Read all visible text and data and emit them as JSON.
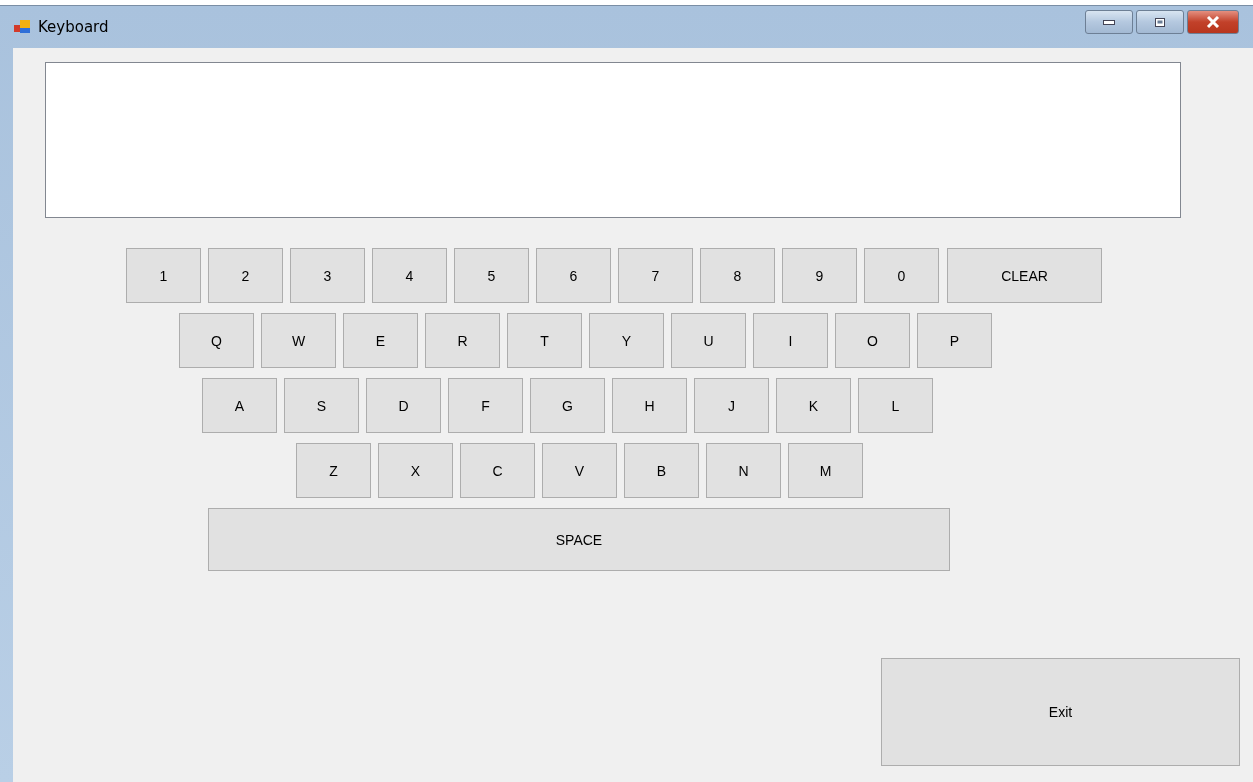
{
  "window": {
    "title": "Keyboard"
  },
  "rows": [
    {
      "keys": [
        "1",
        "2",
        "3",
        "4",
        "5",
        "6",
        "7",
        "8",
        "9",
        "0",
        "CLEAR"
      ]
    },
    {
      "keys": [
        "Q",
        "W",
        "E",
        "R",
        "T",
        "Y",
        "U",
        "I",
        "O",
        "P"
      ]
    },
    {
      "keys": [
        "A",
        "S",
        "D",
        "F",
        "G",
        "H",
        "J",
        "K",
        "L"
      ]
    },
    {
      "keys": [
        "Z",
        "X",
        "C",
        "V",
        "B",
        "N",
        "M"
      ]
    }
  ],
  "space_key": "SPACE",
  "exit_button": "Exit"
}
